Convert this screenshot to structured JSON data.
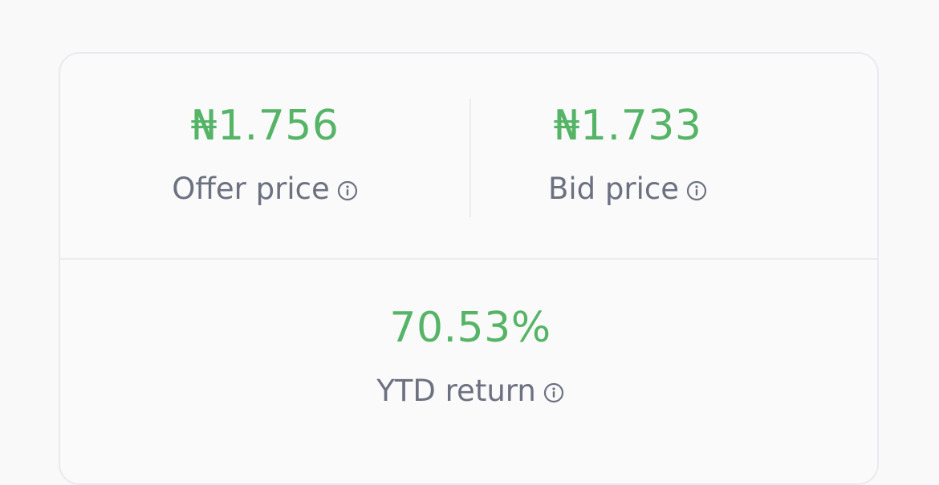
{
  "fund_stats": {
    "offer": {
      "value": "₦1.756",
      "label": "Offer price",
      "icon": "info-icon"
    },
    "bid": {
      "value": "₦1.733",
      "label": "Bid price",
      "icon": "info-icon"
    },
    "ytd": {
      "value": "70.53%",
      "label": "YTD return",
      "icon": "info-icon"
    }
  },
  "colors": {
    "value_green": "#56b467",
    "label_gray": "#6c7180",
    "border": "#e9e9ef",
    "background": "#f9f9fa"
  }
}
